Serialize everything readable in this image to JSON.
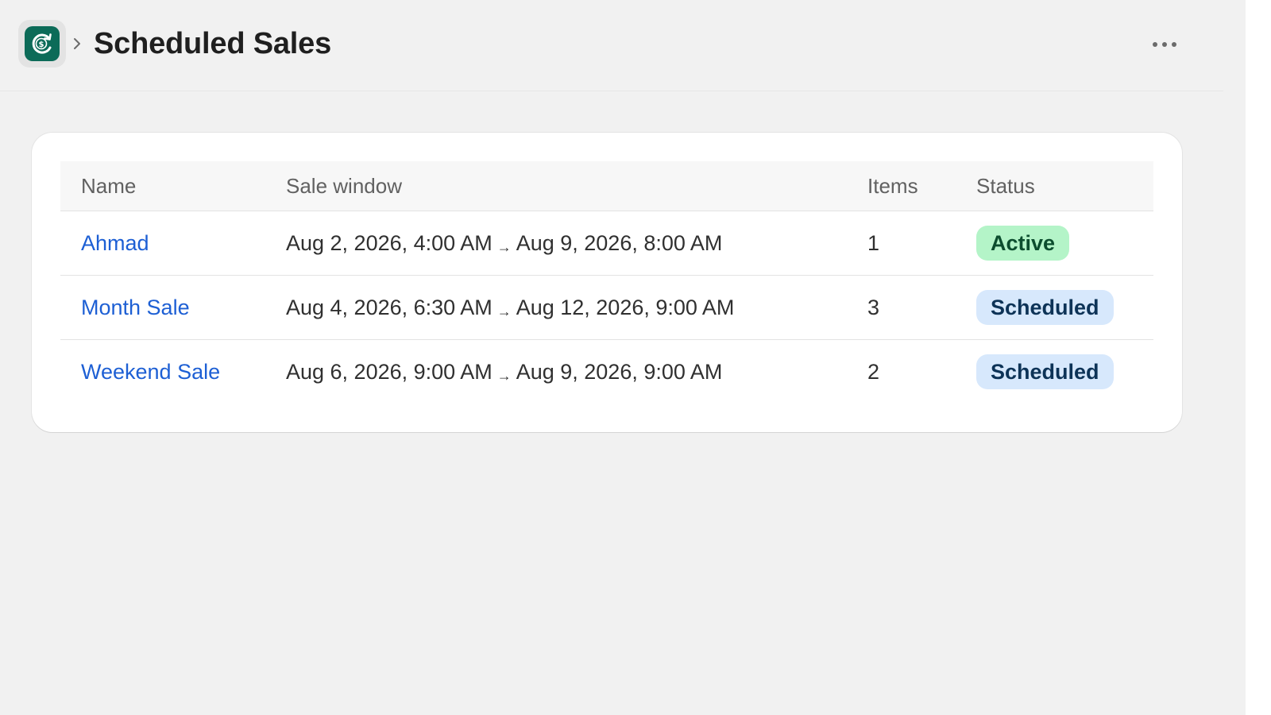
{
  "header": {
    "app_icon": "dollar-sync-icon",
    "breadcrumb_separator_icon": "chevron-right-icon",
    "title": "Scheduled Sales",
    "more_actions_icon": "more-horizontal-icon"
  },
  "colors": {
    "app_brand": "#0c6b58",
    "link": "#1d5fd4",
    "active_badge_bg": "#b4f4c8",
    "scheduled_badge_bg": "#d7e8fc"
  },
  "table": {
    "columns": [
      "Name",
      "Sale window",
      "Items",
      "Status"
    ],
    "rows": [
      {
        "name": "Ahmad",
        "start": "Aug 2, 2026, 4:00 AM",
        "arrow": "→",
        "end": "Aug 9, 2026, 8:00 AM",
        "items": "1",
        "status": "Active"
      },
      {
        "name": "Month Sale",
        "start": "Aug 4, 2026, 6:30 AM",
        "arrow": "→",
        "end": "Aug 12, 2026, 9:00 AM",
        "items": "3",
        "status": "Scheduled"
      },
      {
        "name": "Weekend Sale",
        "start": "Aug 6, 2026, 9:00 AM",
        "arrow": "→",
        "end": "Aug 9, 2026, 9:00 AM",
        "items": "2",
        "status": "Scheduled"
      }
    ]
  }
}
